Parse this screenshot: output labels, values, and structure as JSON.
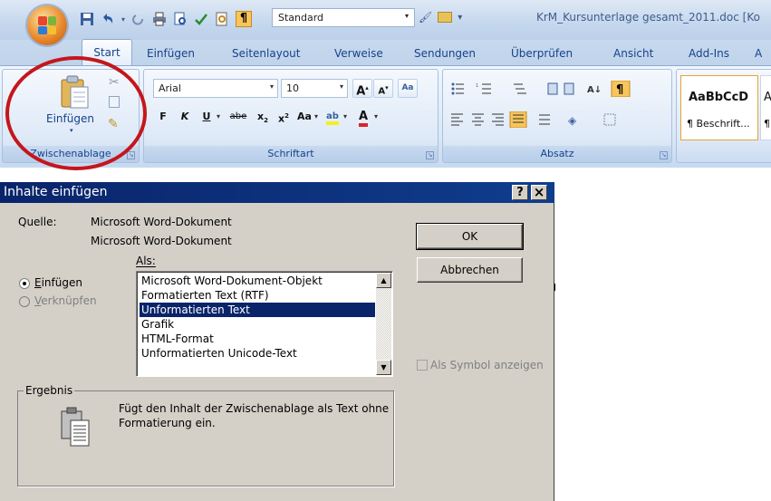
{
  "titlebar": {
    "style_combo": "Standard",
    "doc_title": "KrM_Kursunterlage gesamt_2011.doc [Ko"
  },
  "tabs": [
    "Start",
    "Einfügen",
    "Seitenlayout",
    "Verweise",
    "Sendungen",
    "Überprüfen",
    "Ansicht",
    "Add-Ins",
    "A"
  ],
  "ribbon": {
    "clipboard": {
      "paste_label": "Einfügen",
      "group_label": "Zwischenablage"
    },
    "font": {
      "font_name": "Arial",
      "font_size": "10",
      "group_label": "Schriftart",
      "bold": "F",
      "italic": "K",
      "underline": "U",
      "strike": "abe"
    },
    "paragraph": {
      "group_label": "Absatz"
    },
    "styles": {
      "style1_sample": "AaBbCcD",
      "style1_name": "¶ Beschrift...",
      "style2_sample": "A",
      "style2_name": "¶"
    }
  },
  "dialog": {
    "title": "Inhalte einfügen",
    "help_btn": "?",
    "close_btn": "×",
    "source_label": "Quelle:",
    "source_line1": "Microsoft Word-Dokument",
    "source_line2": "Microsoft Word-Dokument",
    "as_label": "Als:",
    "radio_paste": "Einfügen",
    "radio_link": "Verknüpfen",
    "list_items": [
      "Microsoft Word-Dokument-Objekt",
      "Formatierten Text (RTF)",
      "Unformatierten Text",
      "Grafik",
      "HTML-Format",
      "Unformatierten Unicode-Text"
    ],
    "ok_button": "OK",
    "cancel_button": "Abbrechen",
    "symbol_checkbox": "Als Symbol anzeigen",
    "result_legend": "Ergebnis",
    "result_text": "Fügt den Inhalt der Zwischenablage als Text ohne Formatierung ein."
  },
  "colors": {
    "accent": "#0a246a",
    "highlight_ring": "#c4161c"
  }
}
